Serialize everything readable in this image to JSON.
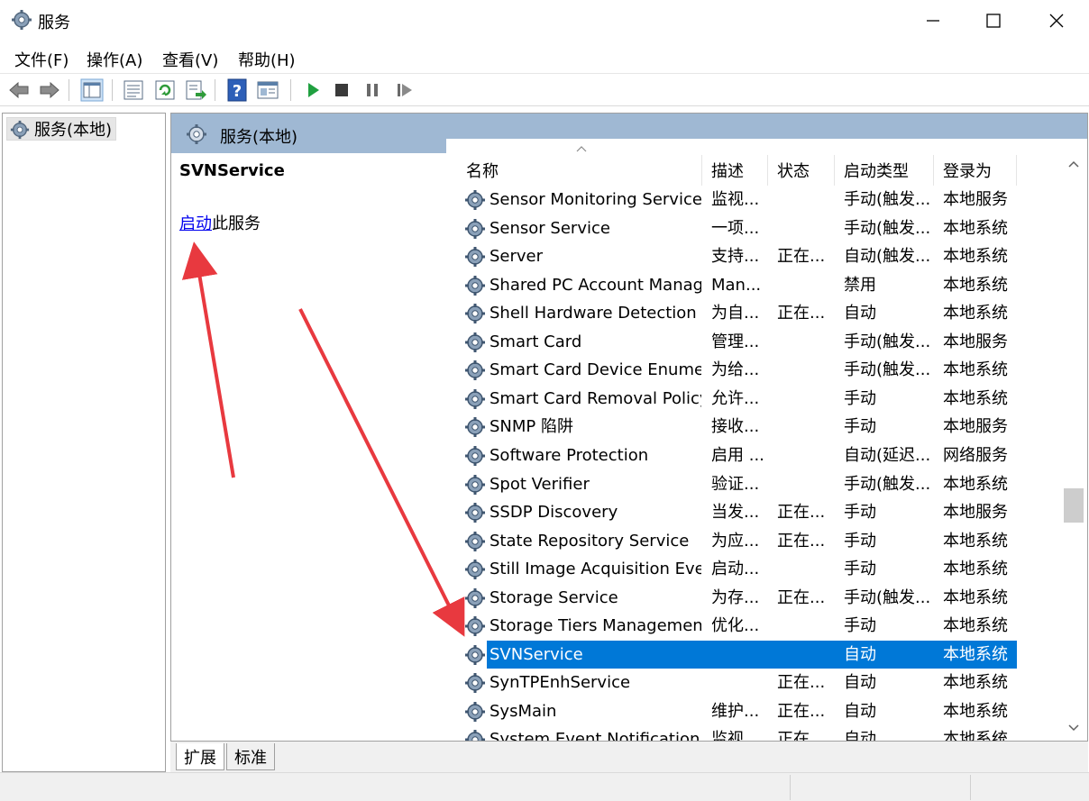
{
  "window": {
    "title": "服务",
    "icon": "gear-icon"
  },
  "menu": {
    "items": [
      "文件(F)",
      "操作(A)",
      "查看(V)",
      "帮助(H)"
    ]
  },
  "toolbar": {
    "buttons": [
      "back-arrow-icon",
      "forward-arrow-icon",
      "show-tree-icon",
      "properties-icon",
      "refresh-icon",
      "export-list-icon",
      "help-icon",
      "view-icon",
      "start-service-icon",
      "stop-service-icon",
      "pause-service-icon",
      "restart-service-icon"
    ]
  },
  "tree": {
    "root_label": "服务(本地)"
  },
  "pane": {
    "header": "服务(本地)",
    "selected_service": "SVNService",
    "action_link": "启动",
    "action_suffix": "此服务"
  },
  "columns": {
    "name": "名称",
    "desc": "描述",
    "status": "状态",
    "startup": "启动类型",
    "logon": "登录为"
  },
  "rows": [
    {
      "name": "Sensor Monitoring Service",
      "desc": "监视...",
      "status": "",
      "startup": "手动(触发...",
      "logon": "本地服务"
    },
    {
      "name": "Sensor Service",
      "desc": "一项...",
      "status": "",
      "startup": "手动(触发...",
      "logon": "本地系统"
    },
    {
      "name": "Server",
      "desc": "支持...",
      "status": "正在...",
      "startup": "自动(触发...",
      "logon": "本地系统"
    },
    {
      "name": "Shared PC Account Manager",
      "desc": "Man...",
      "status": "",
      "startup": "禁用",
      "logon": "本地系统"
    },
    {
      "name": "Shell Hardware Detection",
      "desc": "为自...",
      "status": "正在...",
      "startup": "自动",
      "logon": "本地系统"
    },
    {
      "name": "Smart Card",
      "desc": "管理...",
      "status": "",
      "startup": "手动(触发...",
      "logon": "本地服务"
    },
    {
      "name": "Smart Card Device Enumer...",
      "desc": "为给...",
      "status": "",
      "startup": "手动(触发...",
      "logon": "本地系统"
    },
    {
      "name": "Smart Card Removal Policy",
      "desc": "允许...",
      "status": "",
      "startup": "手动",
      "logon": "本地系统"
    },
    {
      "name": "SNMP 陷阱",
      "desc": "接收...",
      "status": "",
      "startup": "手动",
      "logon": "本地服务"
    },
    {
      "name": "Software Protection",
      "desc": "启用 ...",
      "status": "",
      "startup": "自动(延迟...",
      "logon": "网络服务"
    },
    {
      "name": "Spot Verifier",
      "desc": "验证...",
      "status": "",
      "startup": "手动(触发...",
      "logon": "本地系统"
    },
    {
      "name": "SSDP Discovery",
      "desc": "当发...",
      "status": "正在...",
      "startup": "手动",
      "logon": "本地服务"
    },
    {
      "name": "State Repository Service",
      "desc": "为应...",
      "status": "正在...",
      "startup": "手动",
      "logon": "本地系统"
    },
    {
      "name": "Still Image Acquisition Eve...",
      "desc": "启动...",
      "status": "",
      "startup": "手动",
      "logon": "本地系统"
    },
    {
      "name": "Storage Service",
      "desc": "为存...",
      "status": "正在...",
      "startup": "手动(触发...",
      "logon": "本地系统"
    },
    {
      "name": "Storage Tiers Management",
      "desc": "优化...",
      "status": "",
      "startup": "手动",
      "logon": "本地系统"
    },
    {
      "name": "SVNService",
      "desc": "",
      "status": "",
      "startup": "自动",
      "logon": "本地系统",
      "selected": true
    },
    {
      "name": "SynTPEnhService",
      "desc": "",
      "status": "正在...",
      "startup": "自动",
      "logon": "本地系统"
    },
    {
      "name": "SysMain",
      "desc": "维护...",
      "status": "正在...",
      "startup": "自动",
      "logon": "本地系统"
    },
    {
      "name": "System Event Notification ...",
      "desc": "监视...",
      "status": "正在...",
      "startup": "自动",
      "logon": "本地系统"
    }
  ],
  "tabs": [
    "扩展",
    "标准"
  ],
  "colors": {
    "selection": "#0078d7",
    "header_band": "#9fb8d3",
    "annotation_arrow": "#e8393f",
    "link": "#0000ee"
  }
}
